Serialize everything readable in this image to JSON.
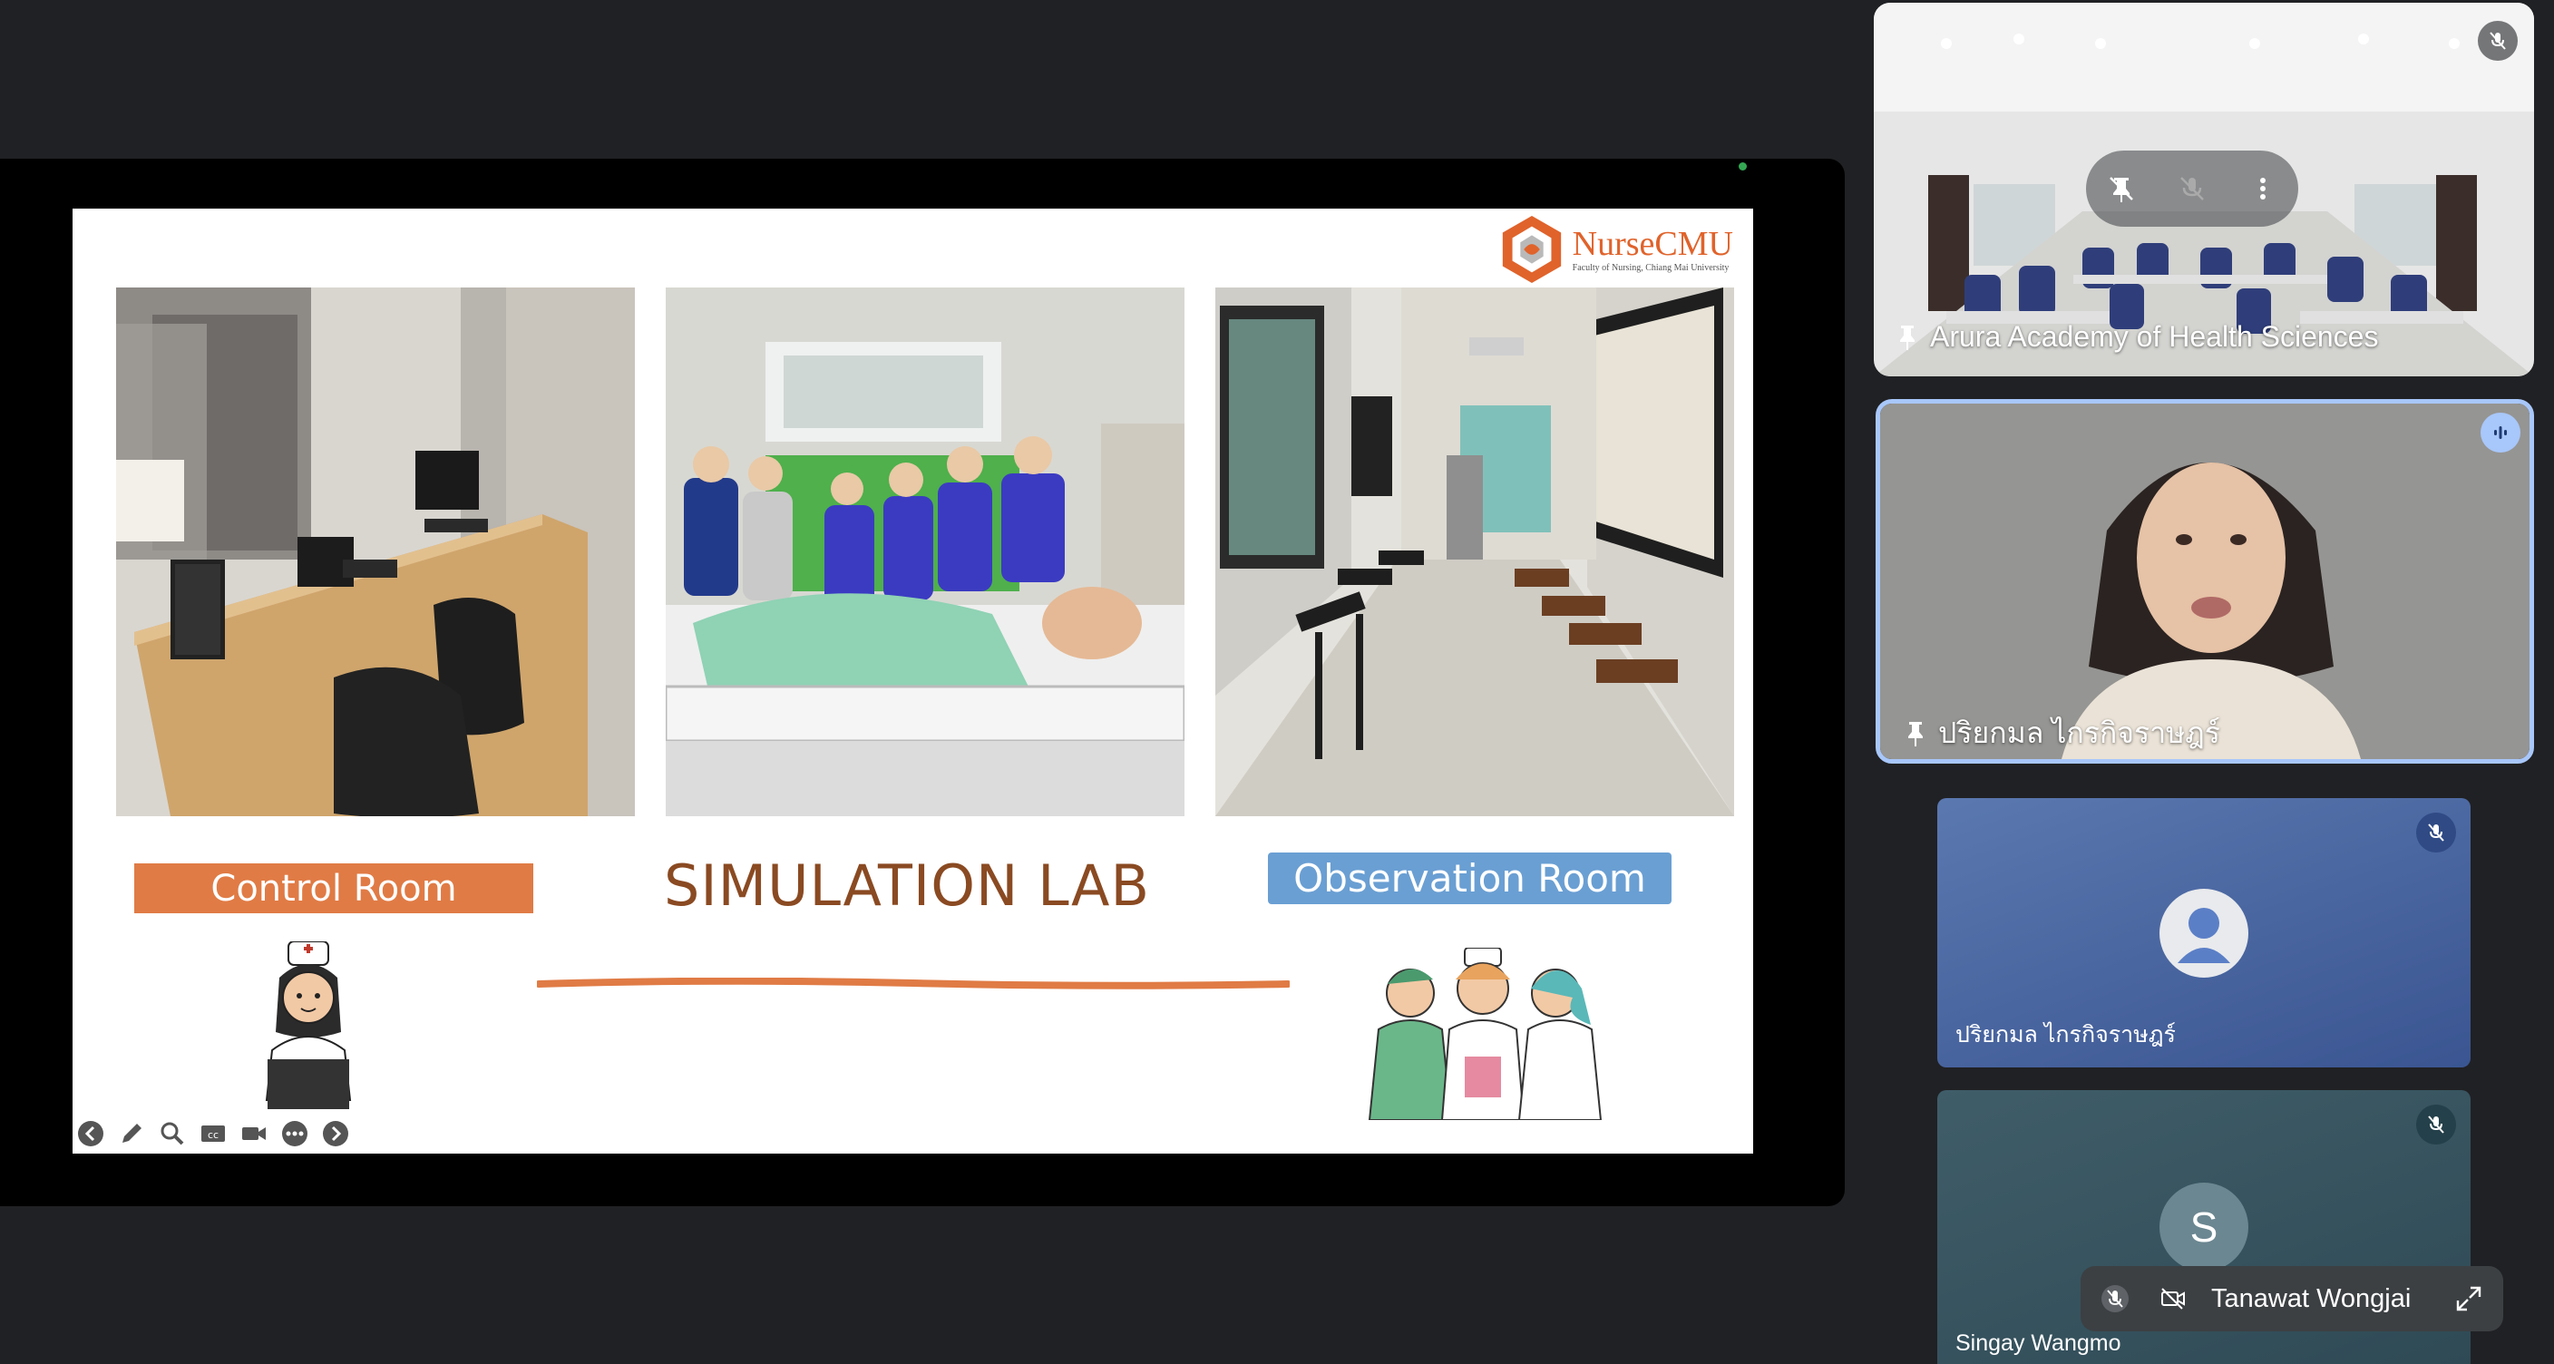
{
  "slide": {
    "logo_name": "NurseCMU",
    "logo_subtitle": "Faculty of Nursing, Chiang Mai University",
    "title": "SIMULATION LAB",
    "label_left": "Control Room",
    "label_right": "Observation Room"
  },
  "participants": {
    "arura": {
      "name": "Arura Academy of Health Sciences"
    },
    "speaker": {
      "name": "ปริยกมล ไกรกิจราษฎร์"
    },
    "tile2": {
      "name": "ปริยกมล ไกรกิจราษฎร์"
    },
    "singay": {
      "name": "Singay Wangmo",
      "avatar_letter": "S"
    }
  },
  "self_view": {
    "name": "Tanawat Wongjai"
  },
  "colors": {
    "accent_orange": "#e07b45",
    "accent_blue": "#6a9fd3",
    "speaker_border": "#a8c7fa",
    "background": "#202124"
  }
}
